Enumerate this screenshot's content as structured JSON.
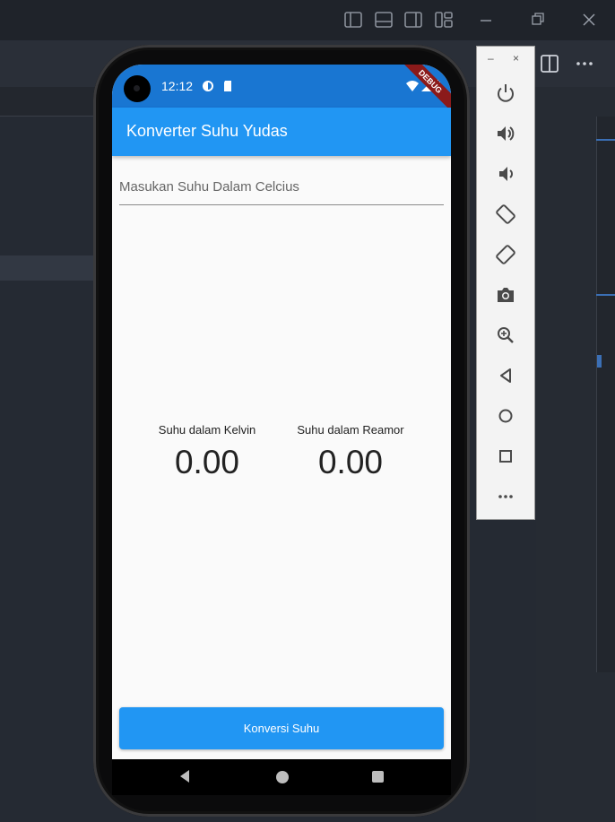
{
  "status_bar": {
    "time": "12:12",
    "debug_banner": "DEBUG"
  },
  "app": {
    "title": "Konverter Suhu Yudas",
    "input_placeholder": "Masukan Suhu Dalam Celcius",
    "input_value": "",
    "kelvin_label": "Suhu dalam Kelvin",
    "kelvin_value": "0.00",
    "reamur_label": "Suhu dalam Reamor",
    "reamur_value": "0.00",
    "convert_button": "Konversi Suhu"
  },
  "emulator_toolbar": {
    "minimize": "–",
    "close": "×",
    "buttons": [
      "power-icon",
      "volume-up-icon",
      "volume-down-icon",
      "rotate-left-icon",
      "rotate-right-icon",
      "camera-icon",
      "zoom-icon",
      "back-icon",
      "home-icon",
      "overview-icon",
      "more-icon"
    ]
  },
  "colors": {
    "app_bar": "#2196f3",
    "status_bar": "#1976d2",
    "button": "#2196f3",
    "editor_bg": "#252a33"
  }
}
